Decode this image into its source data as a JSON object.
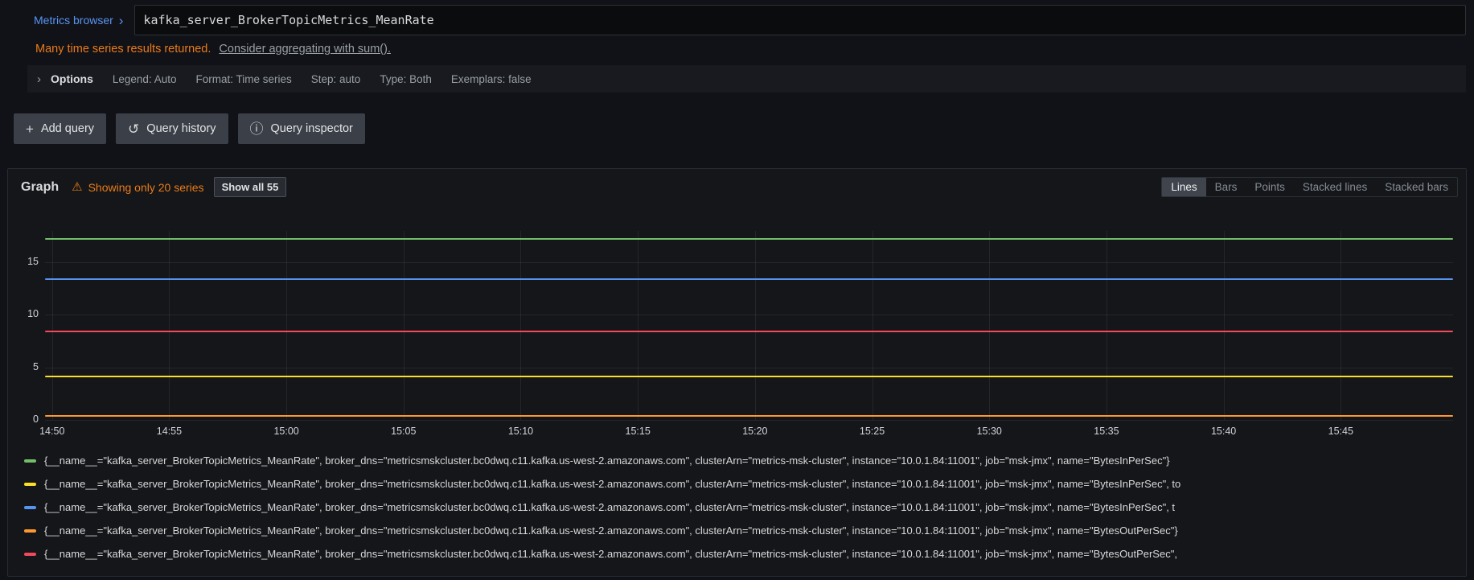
{
  "colors": {
    "warning_orange": "#eb7b18",
    "link_blue": "#5794f2",
    "page_bg": "#111217",
    "panel_bg": "#141619"
  },
  "query_editor": {
    "metrics_browser_label": "Metrics browser",
    "query_input_value": "kafka_server_BrokerTopicMetrics_MeanRate",
    "warning_text": "Many time series results returned.",
    "warning_link": "Consider aggregating with sum().",
    "options": {
      "label": "Options",
      "items": [
        "Legend: Auto",
        "Format: Time series",
        "Step: auto",
        "Type: Both",
        "Exemplars: false"
      ]
    },
    "buttons": [
      {
        "label": "Add query",
        "icon": "plus-icon",
        "name": "add-query-button"
      },
      {
        "label": "Query history",
        "icon": "history-icon",
        "name": "query-history-button"
      },
      {
        "label": "Query inspector",
        "icon": "info-icon",
        "name": "query-inspector-button"
      }
    ]
  },
  "graph_panel": {
    "title": "Graph",
    "warning": "Showing only 20 series",
    "show_all_button": "Show all 55",
    "view_modes": [
      "Lines",
      "Bars",
      "Points",
      "Stacked lines",
      "Stacked bars"
    ],
    "active_mode": "Lines"
  },
  "chart_data": {
    "type": "line",
    "title": "",
    "xlabel": "",
    "ylabel": "",
    "grid": true,
    "legend_position": "bottom",
    "x_ticks": [
      "14:50",
      "14:55",
      "15:00",
      "15:05",
      "15:10",
      "15:15",
      "15:20",
      "15:25",
      "15:30",
      "15:35",
      "15:40",
      "15:45"
    ],
    "x_first_tick_frac": 0.005,
    "x_tick_spacing_frac": 0.0832,
    "y_ticks": [
      0,
      5,
      10,
      15
    ],
    "ylim": [
      0,
      18
    ],
    "note": "All visible series are flat constant lines across the whole time window",
    "series": [
      {
        "label": "{__name__=\"kafka_server_BrokerTopicMetrics_MeanRate\", broker_dns=\"metricsmskcluster.bc0dwq.c11.kafka.us-west-2.amazonaws.com\", clusterArn=\"metrics-msk-cluster\", instance=\"10.0.1.84:11001\", job=\"msk-jmx\", name=\"BytesInPerSec\"}",
        "color": "#73BF69",
        "value": 17.25
      },
      {
        "label": "{__name__=\"kafka_server_BrokerTopicMetrics_MeanRate\", broker_dns=\"metricsmskcluster.bc0dwq.c11.kafka.us-west-2.amazonaws.com\", clusterArn=\"metrics-msk-cluster\", instance=\"10.0.1.84:11001\", job=\"msk-jmx\", name=\"BytesInPerSec\", to",
        "color": "#FADE2A",
        "value": 4.1
      },
      {
        "label": "{__name__=\"kafka_server_BrokerTopicMetrics_MeanRate\", broker_dns=\"metricsmskcluster.bc0dwq.c11.kafka.us-west-2.amazonaws.com\", clusterArn=\"metrics-msk-cluster\", instance=\"10.0.1.84:11001\", job=\"msk-jmx\", name=\"BytesInPerSec\", t",
        "color": "#5794F2",
        "value": 13.4
      },
      {
        "label": "{__name__=\"kafka_server_BrokerTopicMetrics_MeanRate\", broker_dns=\"metricsmskcluster.bc0dwq.c11.kafka.us-west-2.amazonaws.com\", clusterArn=\"metrics-msk-cluster\", instance=\"10.0.1.84:11001\", job=\"msk-jmx\", name=\"BytesOutPerSec\"}",
        "color": "#FF9830",
        "value": 0.35
      },
      {
        "label": "{__name__=\"kafka_server_BrokerTopicMetrics_MeanRate\", broker_dns=\"metricsmskcluster.bc0dwq.c11.kafka.us-west-2.amazonaws.com\", clusterArn=\"metrics-msk-cluster\", instance=\"10.0.1.84:11001\", job=\"msk-jmx\", name=\"BytesOutPerSec\",",
        "color": "#F2495C",
        "value": 8.4
      }
    ]
  }
}
